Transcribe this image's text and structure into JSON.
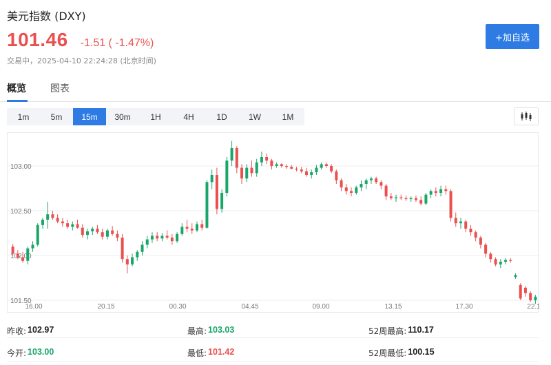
{
  "header": {
    "title": "美元指数 (DXY)",
    "price": "101.46",
    "change": "-1.51 ( -1.47%)",
    "status": "交易中，2025-04-10 22:24:28 (北京时间)",
    "watch_button": "+加自选"
  },
  "tabs": [
    {
      "label": "概览",
      "active": true
    },
    {
      "label": "图表",
      "active": false
    }
  ],
  "ranges": [
    {
      "label": "1m",
      "active": false
    },
    {
      "label": "5m",
      "active": false
    },
    {
      "label": "15m",
      "active": true
    },
    {
      "label": "30m",
      "active": false
    },
    {
      "label": "1H",
      "active": false
    },
    {
      "label": "4H",
      "active": false
    },
    {
      "label": "1D",
      "active": false
    },
    {
      "label": "1W",
      "active": false
    },
    {
      "label": "1M",
      "active": false
    }
  ],
  "chart_type_icon": "candlestick-icon",
  "colors": {
    "up": "#1aa56a",
    "down": "#e9504f",
    "accent": "#2d7be3"
  },
  "chart_data": {
    "type": "candlestick",
    "x_ticks": [
      "16.00",
      "20.15",
      "00.30",
      "04.45",
      "09.00",
      "13.15",
      "17.30",
      "22.1"
    ],
    "y_ticks": [
      "103.00",
      "102.50",
      "102.00",
      "101.50"
    ],
    "ylim": [
      101.5,
      103.3
    ],
    "grid": true,
    "ohlc": [
      [
        102.1,
        102.13,
        102.0,
        102.02
      ],
      [
        102.02,
        102.06,
        101.96,
        101.98
      ],
      [
        101.98,
        102.04,
        101.92,
        101.94
      ],
      [
        101.94,
        102.1,
        101.9,
        102.08
      ],
      [
        102.08,
        102.16,
        102.04,
        102.12
      ],
      [
        102.12,
        102.36,
        102.1,
        102.34
      ],
      [
        102.34,
        102.42,
        102.3,
        102.4
      ],
      [
        102.4,
        102.6,
        102.3,
        102.46
      ],
      [
        102.46,
        102.5,
        102.4,
        102.42
      ],
      [
        102.42,
        102.46,
        102.36,
        102.38
      ],
      [
        102.38,
        102.42,
        102.32,
        102.36
      ],
      [
        102.36,
        102.4,
        102.3,
        102.32
      ],
      [
        102.32,
        102.38,
        102.28,
        102.35
      ],
      [
        102.35,
        102.4,
        102.3,
        102.31
      ],
      [
        102.31,
        102.35,
        102.2,
        102.23
      ],
      [
        102.23,
        102.3,
        102.18,
        102.27
      ],
      [
        102.27,
        102.32,
        102.23,
        102.3
      ],
      [
        102.3,
        102.34,
        102.24,
        102.26
      ],
      [
        102.26,
        102.3,
        102.18,
        102.21
      ],
      [
        102.21,
        102.3,
        102.18,
        102.28
      ],
      [
        102.28,
        102.33,
        102.22,
        102.24
      ],
      [
        102.24,
        102.28,
        102.16,
        102.2
      ],
      [
        102.2,
        102.24,
        101.92,
        101.96
      ],
      [
        101.96,
        102.0,
        101.8,
        101.9
      ],
      [
        101.9,
        102.02,
        101.88,
        101.98
      ],
      [
        101.98,
        102.06,
        101.94,
        102.04
      ],
      [
        102.04,
        102.16,
        102.0,
        102.12
      ],
      [
        102.12,
        102.22,
        102.08,
        102.18
      ],
      [
        102.18,
        102.26,
        102.14,
        102.22
      ],
      [
        102.22,
        102.26,
        102.16,
        102.19
      ],
      [
        102.19,
        102.25,
        102.16,
        102.22
      ],
      [
        102.22,
        102.28,
        102.18,
        102.2
      ],
      [
        102.2,
        102.24,
        102.12,
        102.16
      ],
      [
        102.16,
        102.26,
        102.14,
        102.24
      ],
      [
        102.24,
        102.36,
        102.22,
        102.32
      ],
      [
        102.32,
        102.4,
        102.26,
        102.3
      ],
      [
        102.3,
        102.36,
        102.24,
        102.28
      ],
      [
        102.28,
        102.38,
        102.26,
        102.35
      ],
      [
        102.35,
        102.4,
        102.28,
        102.31
      ],
      [
        102.31,
        102.84,
        102.3,
        102.82
      ],
      [
        102.82,
        102.96,
        102.74,
        102.9
      ],
      [
        102.9,
        102.98,
        102.46,
        102.52
      ],
      [
        102.52,
        102.74,
        102.48,
        102.7
      ],
      [
        102.7,
        103.1,
        102.66,
        103.06
      ],
      [
        103.06,
        103.28,
        103.0,
        103.2
      ],
      [
        103.2,
        103.22,
        102.92,
        102.98
      ],
      [
        102.98,
        103.02,
        102.8,
        102.86
      ],
      [
        102.86,
        103.02,
        102.82,
        102.98
      ],
      [
        102.98,
        103.06,
        102.88,
        102.92
      ],
      [
        102.92,
        103.08,
        102.88,
        103.04
      ],
      [
        103.04,
        103.16,
        103.0,
        103.1
      ],
      [
        103.1,
        103.14,
        103.02,
        103.06
      ],
      [
        103.06,
        103.08,
        102.96,
        103.0
      ],
      [
        103.0,
        103.04,
        102.98,
        103.02
      ],
      [
        103.02,
        103.03,
        102.98,
        103.0
      ],
      [
        103.0,
        103.02,
        102.97,
        102.99
      ],
      [
        102.99,
        103.01,
        102.96,
        102.97
      ],
      [
        102.97,
        102.99,
        102.94,
        102.96
      ],
      [
        102.96,
        102.99,
        102.92,
        102.94
      ],
      [
        102.94,
        102.98,
        102.88,
        102.9
      ],
      [
        102.9,
        102.96,
        102.86,
        102.93
      ],
      [
        102.93,
        103.01,
        102.9,
        102.98
      ],
      [
        102.98,
        103.04,
        102.96,
        103.02
      ],
      [
        103.02,
        103.04,
        102.98,
        103.0
      ],
      [
        103.0,
        103.02,
        102.92,
        102.94
      ],
      [
        102.94,
        102.96,
        102.8,
        102.84
      ],
      [
        102.84,
        102.86,
        102.72,
        102.76
      ],
      [
        102.76,
        102.8,
        102.68,
        102.72
      ],
      [
        102.72,
        102.76,
        102.66,
        102.7
      ],
      [
        102.7,
        102.78,
        102.68,
        102.76
      ],
      [
        102.76,
        102.84,
        102.72,
        102.8
      ],
      [
        102.8,
        102.86,
        102.74,
        102.84
      ],
      [
        102.84,
        102.88,
        102.8,
        102.86
      ],
      [
        102.86,
        102.88,
        102.8,
        102.82
      ],
      [
        102.82,
        102.84,
        102.74,
        102.78
      ],
      [
        102.78,
        102.8,
        102.62,
        102.66
      ],
      [
        102.66,
        102.7,
        102.62,
        102.64
      ],
      [
        102.64,
        102.68,
        102.6,
        102.65
      ],
      [
        102.65,
        102.68,
        102.62,
        102.64
      ],
      [
        102.64,
        102.67,
        102.61,
        102.63
      ],
      [
        102.63,
        102.66,
        102.6,
        102.64
      ],
      [
        102.64,
        102.67,
        102.6,
        102.62
      ],
      [
        102.62,
        102.66,
        102.56,
        102.58
      ],
      [
        102.58,
        102.7,
        102.56,
        102.68
      ],
      [
        102.68,
        102.74,
        102.64,
        102.72
      ],
      [
        102.72,
        102.76,
        102.66,
        102.7
      ],
      [
        102.7,
        102.78,
        102.66,
        102.74
      ],
      [
        102.74,
        102.78,
        102.68,
        102.72
      ],
      [
        102.72,
        102.74,
        102.38,
        102.42
      ],
      [
        102.42,
        102.48,
        102.32,
        102.36
      ],
      [
        102.36,
        102.42,
        102.3,
        102.38
      ],
      [
        102.38,
        102.4,
        102.26,
        102.3
      ],
      [
        102.3,
        102.34,
        102.22,
        102.26
      ],
      [
        102.26,
        102.28,
        102.16,
        102.2
      ],
      [
        102.2,
        102.22,
        102.08,
        102.12
      ],
      [
        102.12,
        102.14,
        101.98,
        102.02
      ],
      [
        102.02,
        102.04,
        101.92,
        101.96
      ],
      [
        101.96,
        101.98,
        101.88,
        101.9
      ],
      [
        101.9,
        101.96,
        101.86,
        101.93
      ],
      [
        101.93,
        101.97,
        101.9,
        101.95
      ],
      [
        101.95,
        101.97,
        101.92,
        101.94
      ],
      [
        101.76,
        101.8,
        101.74,
        101.78
      ],
      [
        101.67,
        101.69,
        101.5,
        101.52
      ],
      [
        101.64,
        101.66,
        101.54,
        101.58
      ],
      [
        101.58,
        101.6,
        101.48,
        101.5
      ],
      [
        101.5,
        101.56,
        101.46,
        101.54
      ]
    ]
  },
  "stats": [
    {
      "label": "昨收:",
      "value": "102.97",
      "tone": "neutral"
    },
    {
      "label": "最高:",
      "value": "103.03",
      "tone": "up"
    },
    {
      "label": "52周最高:",
      "value": "110.17",
      "tone": "neutral"
    },
    {
      "label": "今开:",
      "value": "103.00",
      "tone": "up"
    },
    {
      "label": "最低:",
      "value": "101.42",
      "tone": "down"
    },
    {
      "label": "52周最低:",
      "value": "100.15",
      "tone": "neutral"
    }
  ]
}
